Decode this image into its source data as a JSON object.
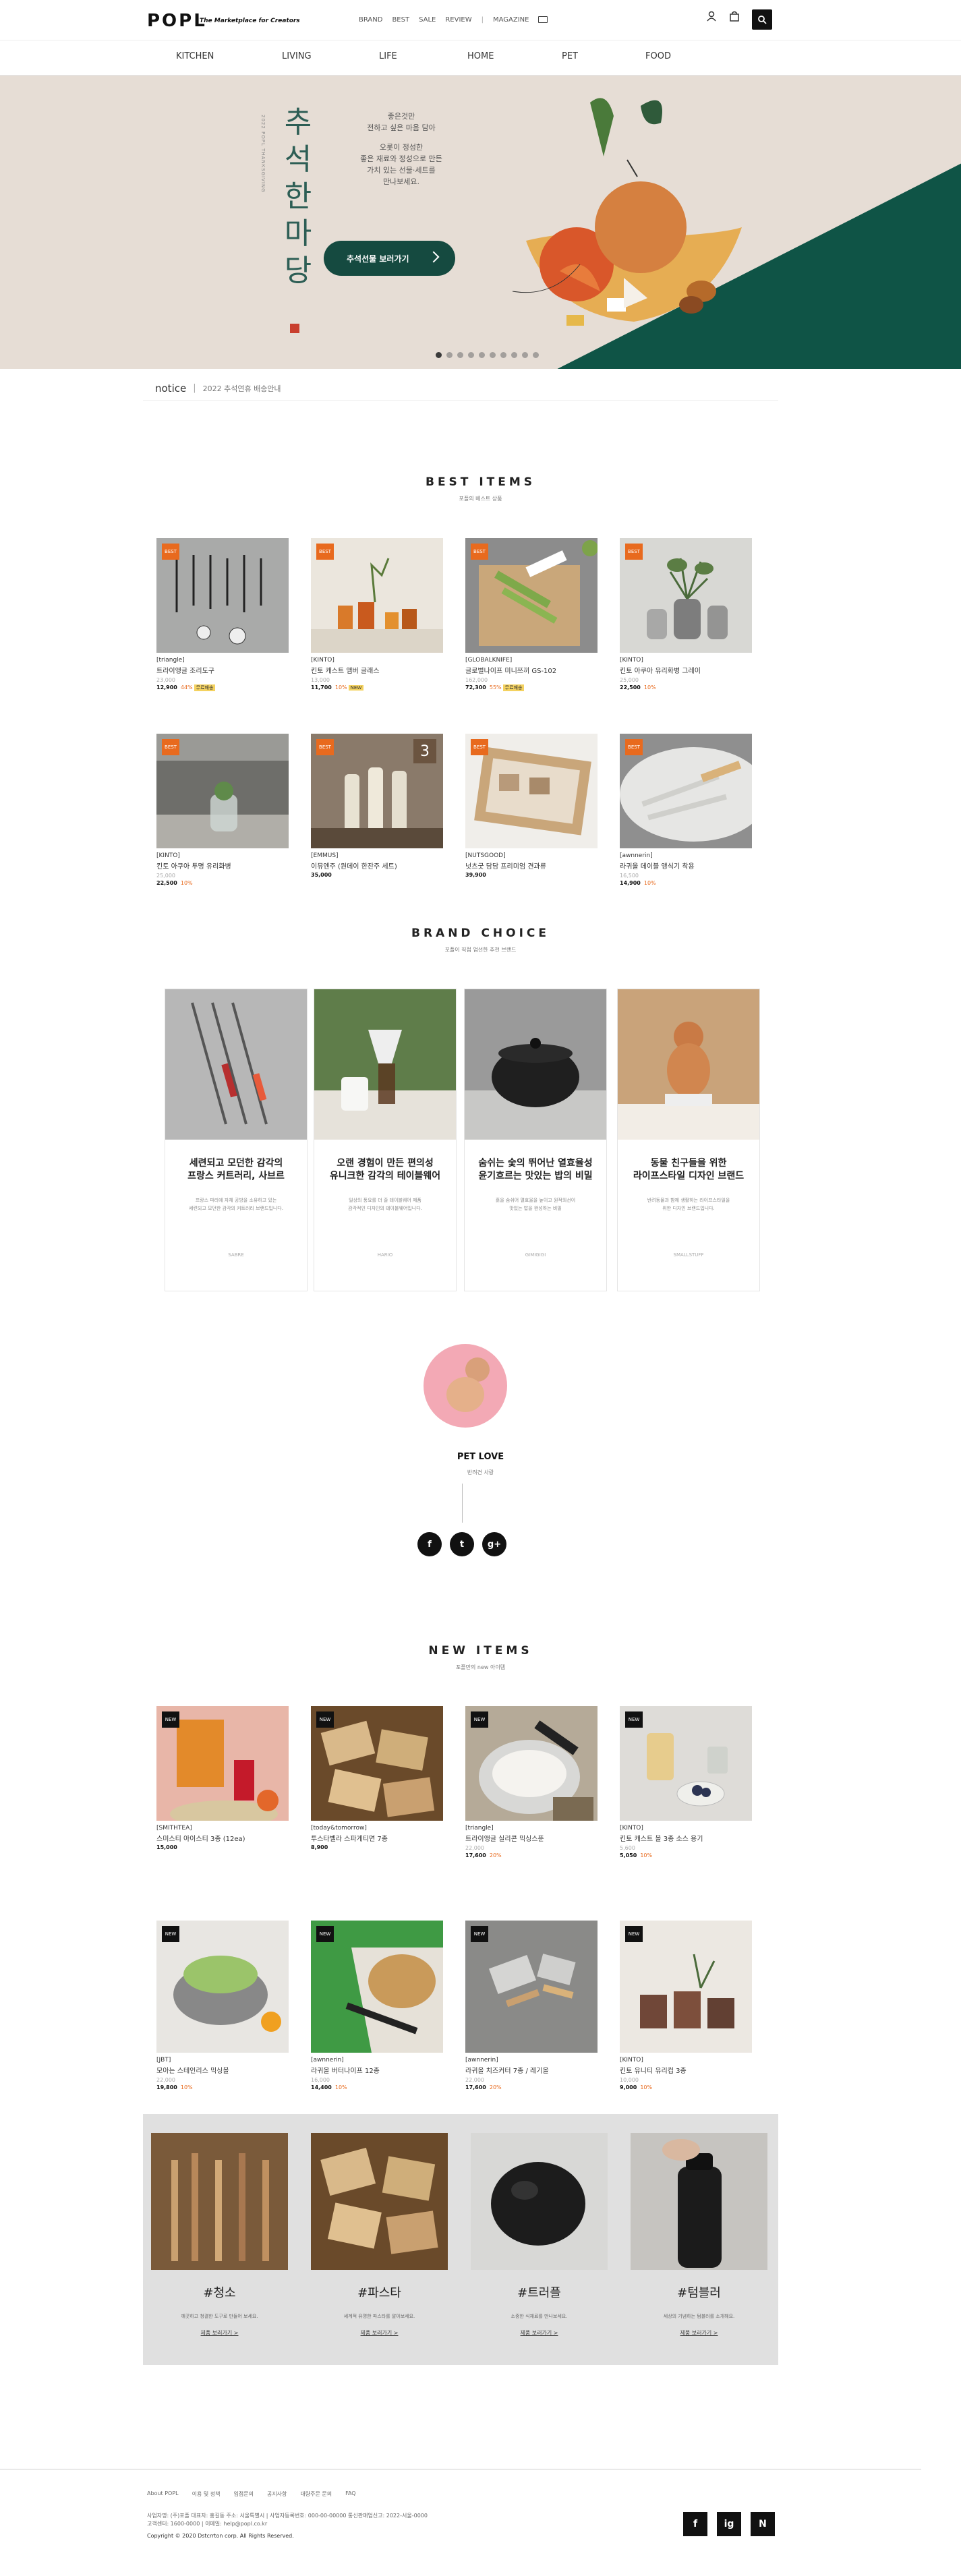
{
  "header": {
    "logo": "POPL",
    "tagline": "The Marketplace for Creators",
    "gnb": [
      "BRAND",
      "BEST",
      "SALE",
      "REVIEW",
      "MAGAZINE"
    ],
    "categories": [
      "KITCHEN",
      "LIVING",
      "LIFE",
      "HOME",
      "PET",
      "FOOD"
    ]
  },
  "hero": {
    "title": "추석한마당",
    "vertical_sub": "2022 POPL THANKSGIVING",
    "copy1": "좋은것만\n전하고 싶은 마음 담아",
    "copy2": "오롯이 정성한\n좋은 재료와 정성으로 만든\n가치 있는 선물·세트를\n만나보세요.",
    "cta": "추석선물 보러가기",
    "slide_count": 10,
    "active_slide": 1
  },
  "notice": {
    "label": "notice",
    "text": "2022 추석연휴 배송안내"
  },
  "best": {
    "title": "BEST ITEMS",
    "subtitle": "포플의 베스트 상품",
    "products": [
      {
        "badge": "BEST",
        "brand": "[triangle]",
        "name": "트라이앵글 조리도구",
        "old": "23,000",
        "price": "12,900",
        "pct": "44%",
        "tag": "무료배송"
      },
      {
        "badge": "BEST",
        "brand": "[KINTO]",
        "name": "킨토 캐스트 앰버 글래스",
        "old": "13,000",
        "price": "11,700",
        "pct": "10%",
        "tag": "NEW"
      },
      {
        "badge": "BEST",
        "brand": "[GLOBALKNIFE]",
        "name": "글로벌나이프 미니쯔끼 GS-102",
        "old": "162,000",
        "price": "72,300",
        "pct": "55%",
        "tag": "무료배송"
      },
      {
        "badge": "BEST",
        "brand": "[KINTO]",
        "name": "킨토 아쿠아 유리화병 그레이",
        "old": "25,000",
        "price": "22,500",
        "pct": "10%",
        "tag": ""
      },
      {
        "badge": "BEST",
        "brand": "[KINTO]",
        "name": "킨토 아쿠아 투명 유리화병",
        "old": "25,000",
        "price": "22,500",
        "pct": "10%",
        "tag": ""
      },
      {
        "badge": "BEST",
        "brand": "[EMMUS]",
        "name": "이뮤엔주 (원데이 한잔주 세트)",
        "old": "",
        "price": "35,000",
        "pct": "",
        "tag": "",
        "num": "3"
      },
      {
        "badge": "BEST",
        "brand": "[NUTSGOOD]",
        "name": "넛츠굿 담담 프리미엄 견과류",
        "old": "",
        "price": "39,900",
        "pct": "",
        "tag": ""
      },
      {
        "badge": "BEST",
        "brand": "[awnnerin]",
        "name": "라귀올 데이블 앵식기 착용",
        "old": "16,500",
        "price": "14,900",
        "pct": "10%",
        "tag": ""
      }
    ]
  },
  "brand_choice": {
    "title": "BRAND CHOICE",
    "subtitle": "포플이 직접 엄선한 추천 브랜드",
    "cards": [
      {
        "title": "세련되고 모던한 감각의\n프랑스 커트러리, 사브르",
        "desc": "프랑스 파리에 자체 공방을 소유하고 있는\n세련되고 모던한 감각의 커트러리 브랜드입니다.",
        "brand": "SABRE"
      },
      {
        "title": "오랜 경험이 만든 편의성\n유니크한 감각의 테이블웨어",
        "desc": "일상의 풍요를 더 줄 테이블웨어 제품\n감각적인 디자인의 테이블웨어입니다.",
        "brand": "HARIO"
      },
      {
        "title": "숨쉬는 숯의 뛰어난 열효율성\n윤기흐르는 맛있는 밥의 비밀",
        "desc": "흙을 숨쉬어 열효율을 높이고 원적외선이\n맛있는 밥을 완성하는 비밀",
        "brand": "GIMIGIGI"
      },
      {
        "title": "동물 친구들을 위한\n라이프스타일 디자인 브랜드",
        "desc": "반려동물과 함께 생활하는 라이프스타일을\n위한 디자인 브랜드입니다.",
        "brand": "SMALLSTUFF"
      }
    ]
  },
  "pet_love": {
    "title": "PET LOVE",
    "subtitle": "반려견 사랑",
    "social": [
      "f",
      "t",
      "g+"
    ]
  },
  "new_items": {
    "title": "NEW ITEMS",
    "subtitle": "포플만의 new 아이템",
    "products": [
      {
        "badge": "NEW",
        "brand": "[SMITHTEA]",
        "name": "스미스티 아이스티 3종 (12ea)",
        "old": "",
        "price": "15,000",
        "pct": "",
        "tag": ""
      },
      {
        "badge": "NEW",
        "brand": "[today&tomorrow]",
        "name": "투스타벨라 스파게티면 7종",
        "old": "",
        "price": "8,900",
        "pct": "",
        "tag": ""
      },
      {
        "badge": "NEW",
        "brand": "[triangle]",
        "name": "트라이앵글 실리콘 믹싱스푼",
        "old": "22,000",
        "price": "17,600",
        "pct": "20%",
        "tag": ""
      },
      {
        "badge": "NEW",
        "brand": "[KINTO]",
        "name": "킨토 캐스트 볼 3종 소스 용기",
        "old": "5,600",
        "price": "5,050",
        "pct": "10%",
        "tag": ""
      },
      {
        "badge": "NEW",
        "brand": "[JBT]",
        "name": "모아는 스테인리스 믹싱볼",
        "old": "22,000",
        "price": "19,800",
        "pct": "10%",
        "tag": ""
      },
      {
        "badge": "NEW",
        "brand": "[awnnerin]",
        "name": "라귀올 버터나이프 12종",
        "old": "16,000",
        "price": "14,400",
        "pct": "10%",
        "tag": ""
      },
      {
        "badge": "NEW",
        "brand": "[awnnerin]",
        "name": "라귀올 치즈커터 7종 / 레기올",
        "old": "22,000",
        "price": "17,600",
        "pct": "20%",
        "tag": ""
      },
      {
        "badge": "NEW",
        "brand": "[KINTO]",
        "name": "킨토 유니티 유리컵 3종",
        "old": "10,000",
        "price": "9,000",
        "pct": "10%",
        "tag": ""
      }
    ]
  },
  "hashtags": [
    {
      "title": "#청소",
      "desc": "깨끗하고 청결한 도구로 만들어 보세요.",
      "more": "제품 보러가기 >"
    },
    {
      "title": "#파스타",
      "desc": "세계적 유명한 파스타를 알아보세요.",
      "more": "제품 보러가기 >"
    },
    {
      "title": "#트러플",
      "desc": "소중한 식재료를 만나보세요.",
      "more": "제품 보러가기 >"
    },
    {
      "title": "#텀블러",
      "desc": "세상의 기념하는 텀블러를 소개해요.",
      "more": "제품 보러가기 >"
    }
  ],
  "footer": {
    "links": [
      "About POPL",
      "이용 및 정책",
      "입점문의",
      "공지사항",
      "대량주문 문의",
      "FAQ"
    ],
    "info1": "사업자명: (주)포플 대표자: 홍길동 주소: 서울특별시 | 사업자등록번호: 000-00-00000 통신판매업신고: 2022-서울-0000",
    "info2": "고객센터: 1600-0000 | 이메일: help@popl.co.kr",
    "copyright": "Copyright © 2020 Dstcrrton corp. All Rights Reserved.",
    "social": [
      "f",
      "ig",
      "N"
    ]
  }
}
